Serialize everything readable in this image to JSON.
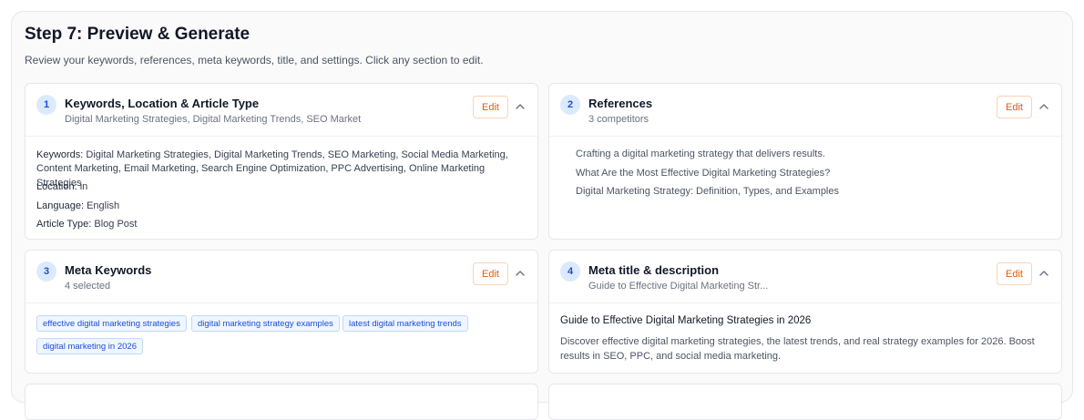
{
  "step": {
    "title": "Step 7: Preview & Generate",
    "subtitle": "Review your keywords, references, meta keywords, title, and settings. Click any section to edit."
  },
  "cards": {
    "keywords": {
      "number": "1",
      "title": "Keywords, Location & Article Type",
      "summary": "Digital Marketing Strategies, Digital Marketing Trends, SEO Marketing",
      "edit_label": "Edit",
      "keywords_label": "Keywords:",
      "keywords_value": "Digital Marketing Strategies, Digital Marketing Trends, SEO Marketing, Social Media Marketing, Content Marketing, Email Marketing, Search Engine Optimization, PPC Advertising, Online Marketing Strategies",
      "location_label": "Location:",
      "location_value": "in",
      "language_label": "Language:",
      "language_value": "English",
      "article_type_label": "Article Type:",
      "article_type_value": "Blog Post"
    },
    "references": {
      "number": "2",
      "title": "References",
      "summary": "3 competitors",
      "edit_label": "Edit",
      "items": [
        "Crafting a digital marketing strategy that delivers results.",
        "What Are the Most Effective Digital Marketing Strategies?",
        "Digital Marketing Strategy: Definition, Types, and Examples"
      ]
    },
    "meta_keywords": {
      "number": "3",
      "title": "Meta Keywords",
      "summary": "4 selected",
      "edit_label": "Edit",
      "tags": [
        "effective digital marketing strategies",
        "digital marketing strategy examples",
        "latest digital marketing trends",
        "digital marketing in 2026"
      ]
    },
    "meta_title": {
      "number": "4",
      "title": "Meta title & description",
      "summary": "Guide to Effective Digital Marketing Str...",
      "edit_label": "Edit",
      "meta_title": "Guide to Effective Digital Marketing Strategies in 2026",
      "meta_description": "Discover effective digital marketing strategies, the latest trends, and real strategy examples for 2026. Boost results in SEO, PPC, and social media marketing."
    }
  },
  "colors": {
    "accent_orange": "#ea580c",
    "badge_blue": "#dbeafe",
    "tag_blue": "#eff6ff"
  }
}
